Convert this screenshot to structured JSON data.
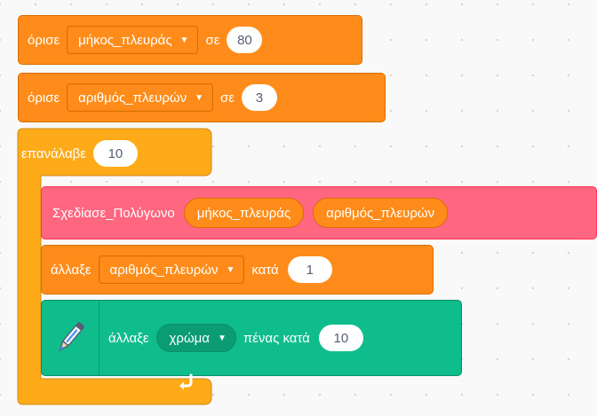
{
  "set_length": {
    "label": "όρισε",
    "variable": "μήκος_πλευράς",
    "to_label": "σε",
    "value": "80"
  },
  "set_sides": {
    "label": "όρισε",
    "variable": "αριθμός_πλευρών",
    "to_label": "σε",
    "value": "3"
  },
  "repeat": {
    "label": "επανάλαβε",
    "count": "10"
  },
  "draw_polygon": {
    "label": "Σχεδίασε_Πολύγωνο",
    "arg1": "μήκος_πλευράς",
    "arg2": "αριθμός_πλευρών"
  },
  "change_sides": {
    "label": "άλλαξε",
    "variable": "αριθμός_πλευρών",
    "by_label": "κατά",
    "value": "1"
  },
  "pen_change": {
    "label": "άλλαξε",
    "param": "χρώμα",
    "suffix": "πένας κατά",
    "value": "10"
  },
  "icons": {
    "dropdown": "triangle-down-icon",
    "pen": "pen-icon",
    "loop": "loop-arrow-icon"
  },
  "colors": {
    "variables": "#ff8c1a",
    "control": "#ffab19",
    "custom": "#ff6680",
    "pen": "#0fbd8c",
    "background": "#f9f9f9"
  }
}
